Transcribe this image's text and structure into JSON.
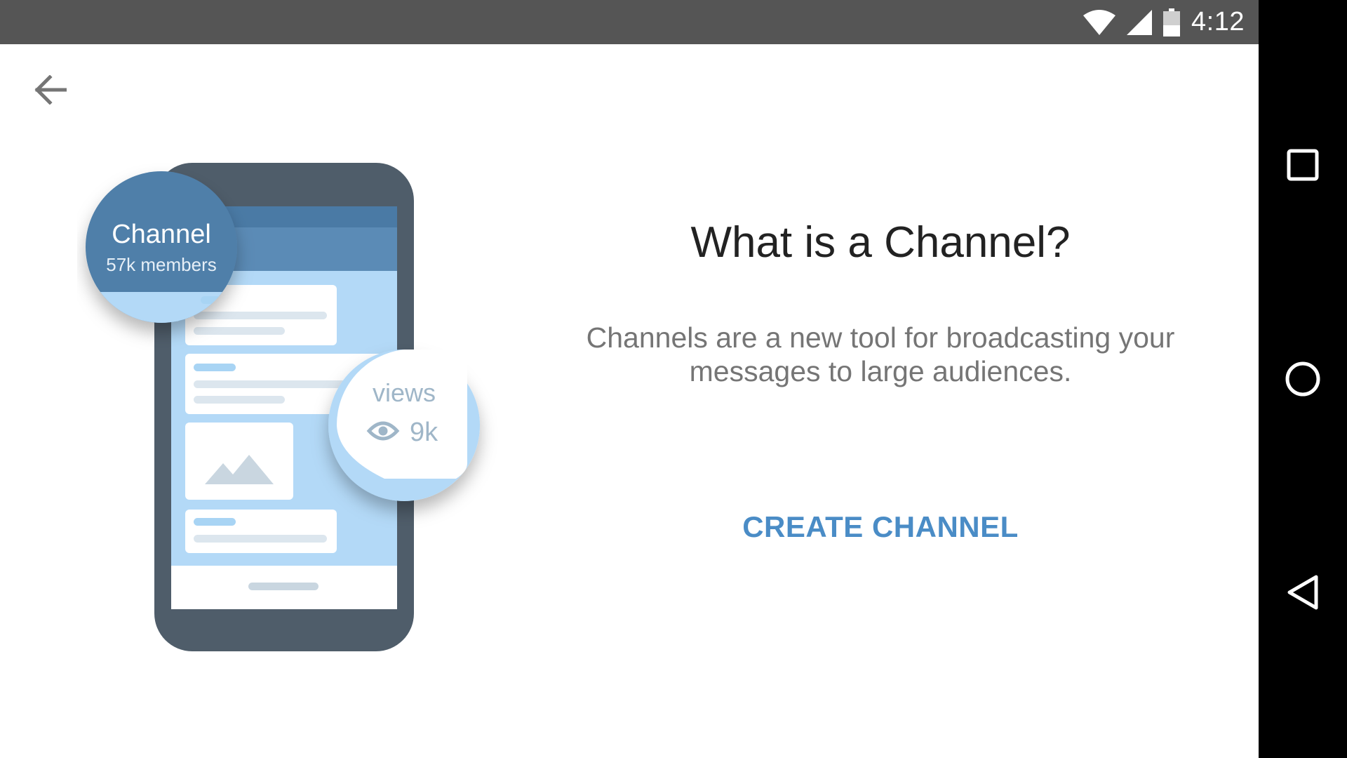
{
  "status_bar": {
    "time": "4:12",
    "icons": [
      "wifi-icon",
      "cell-signal-icon",
      "battery-icon"
    ]
  },
  "navigation": {
    "back_icon": "back-arrow-icon",
    "system_buttons": [
      "recents-square-icon",
      "home-circle-icon",
      "back-triangle-icon"
    ]
  },
  "illustration": {
    "channel_badge_title": "Channel",
    "channel_badge_subtitle": "57k members",
    "views_badge_label": "views",
    "views_badge_count": "9k",
    "views_icon": "eye-icon"
  },
  "intro": {
    "title": "What is a Channel?",
    "description_line1": "Channels are a new tool for broadcasting your",
    "description_line2": "messages to large audiences.",
    "create_button_label": "CREATE CHANNEL"
  },
  "colors": {
    "status_bar": "#555555",
    "nav_bar": "#000000",
    "accent": "#4a8cc6",
    "title": "#222222",
    "description": "#757575",
    "phone_frame": "#4f5d6a",
    "phone_screen": "#b3d9f7",
    "phone_header": "#5b8bb6",
    "channel_badge": "#507fa9",
    "views_badge_text": "#9fb6c8"
  }
}
